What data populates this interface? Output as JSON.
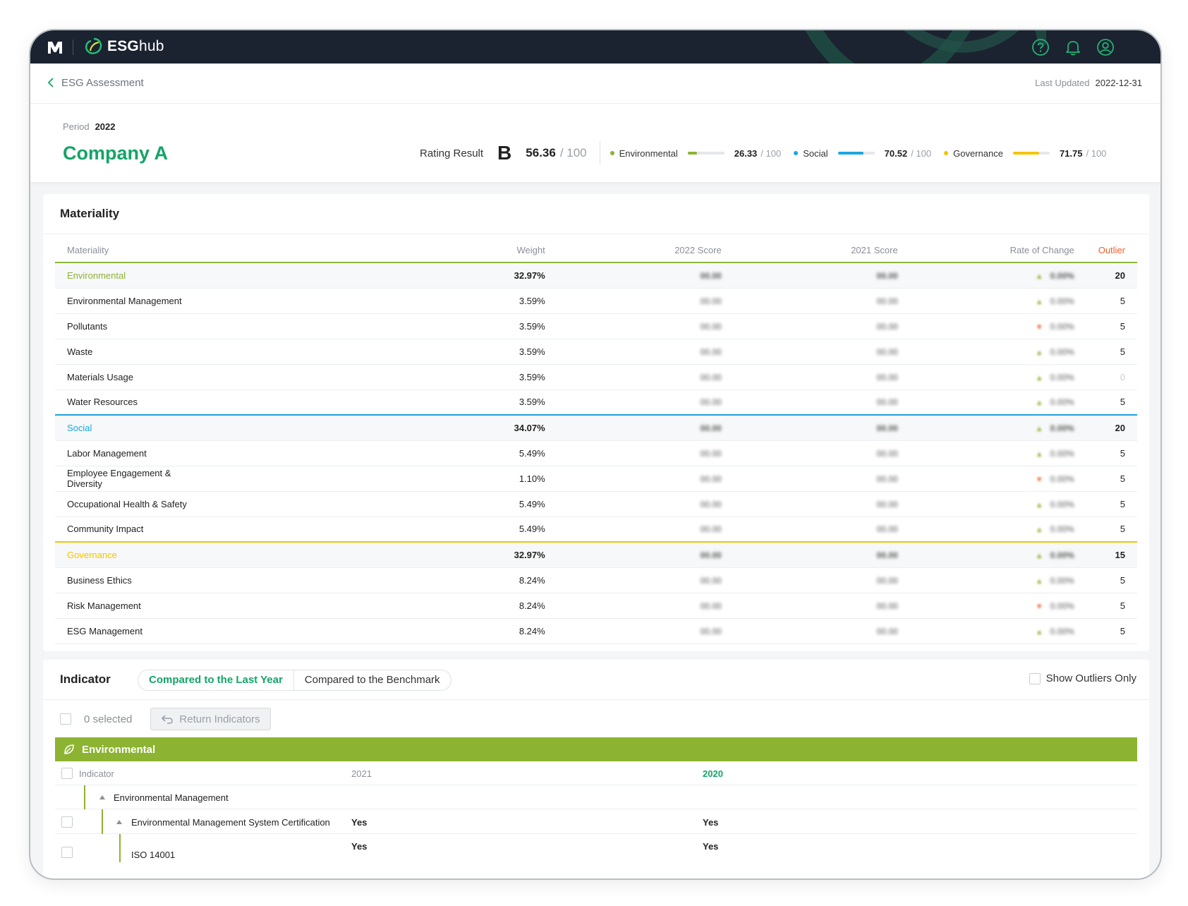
{
  "app": {
    "brand_bold": "ESG",
    "brand_light": "hub"
  },
  "header": {
    "back_label": "ESG Assessment",
    "last_updated_label": "Last Updated",
    "last_updated_value": "2022-12-31",
    "period_label": "Period",
    "period_value": "2022",
    "company": "Company A"
  },
  "rating": {
    "label": "Rating Result",
    "grade": "B",
    "score": "56.36",
    "out_of": "/ 100",
    "pillars": [
      {
        "name": "Environmental",
        "value": "26.33",
        "out_of": "/ 100",
        "fill": 0.2633,
        "color": "#8db332"
      },
      {
        "name": "Social",
        "value": "70.52",
        "out_of": "/ 100",
        "fill": 0.7052,
        "color": "#1aa7e0"
      },
      {
        "name": "Governance",
        "value": "71.75",
        "out_of": "/ 100",
        "fill": 0.7175,
        "color": "#f5c400"
      }
    ]
  },
  "materiality": {
    "title": "Materiality",
    "columns": [
      "Materiality",
      "Weight",
      "2022 Score",
      "2021 Score",
      "Rate of Change",
      "Outlier"
    ],
    "rows": [
      {
        "name": "Environmental",
        "weight": "32.97%",
        "s22": "00.00",
        "s21": "00.00",
        "rate": "0.00%",
        "dir": "up",
        "outlier": "20",
        "group": "env"
      },
      {
        "name": "Environmental Management",
        "weight": "3.59%",
        "s22": "00.00",
        "s21": "00.00",
        "rate": "0.00%",
        "dir": "up",
        "outlier": "5"
      },
      {
        "name": "Pollutants",
        "weight": "3.59%",
        "s22": "00.00",
        "s21": "00.00",
        "rate": "0.00%",
        "dir": "down",
        "outlier": "5"
      },
      {
        "name": "Waste",
        "weight": "3.59%",
        "s22": "00.00",
        "s21": "00.00",
        "rate": "0.00%",
        "dir": "up",
        "outlier": "5"
      },
      {
        "name": "Materials Usage",
        "weight": "3.59%",
        "s22": "00.00",
        "s21": "00.00",
        "rate": "0.00%",
        "dir": "up",
        "outlier": "0"
      },
      {
        "name": "Water Resources",
        "weight": "3.59%",
        "s22": "00.00",
        "s21": "00.00",
        "rate": "0.00%",
        "dir": "up",
        "outlier": "5"
      },
      {
        "name": "Social",
        "weight": "34.07%",
        "s22": "00.00",
        "s21": "00.00",
        "rate": "0.00%",
        "dir": "up",
        "outlier": "20",
        "group": "soc"
      },
      {
        "name": "Labor Management",
        "weight": "5.49%",
        "s22": "00.00",
        "s21": "00.00",
        "rate": "0.00%",
        "dir": "up",
        "outlier": "5"
      },
      {
        "name": "Employee Engagement & Diversity",
        "weight": "1.10%",
        "s22": "00.00",
        "s21": "00.00",
        "rate": "0.00%",
        "dir": "down",
        "outlier": "5"
      },
      {
        "name": "Occupational Health & Safety",
        "weight": "5.49%",
        "s22": "00.00",
        "s21": "00.00",
        "rate": "0.00%",
        "dir": "up",
        "outlier": "5"
      },
      {
        "name": "Community Impact",
        "weight": "5.49%",
        "s22": "00.00",
        "s21": "00.00",
        "rate": "0.00%",
        "dir": "up",
        "outlier": "5"
      },
      {
        "name": "Governance",
        "weight": "32.97%",
        "s22": "00.00",
        "s21": "00.00",
        "rate": "0.00%",
        "dir": "up",
        "outlier": "15",
        "group": "gov"
      },
      {
        "name": "Business Ethics",
        "weight": "8.24%",
        "s22": "00.00",
        "s21": "00.00",
        "rate": "0.00%",
        "dir": "up",
        "outlier": "5"
      },
      {
        "name": "Risk Management",
        "weight": "8.24%",
        "s22": "00.00",
        "s21": "00.00",
        "rate": "0.00%",
        "dir": "down",
        "outlier": "5"
      },
      {
        "name": "ESG Management",
        "weight": "8.24%",
        "s22": "00.00",
        "s21": "00.00",
        "rate": "0.00%",
        "dir": "up",
        "outlier": "5"
      }
    ],
    "group_colors": {
      "env": "#8db332",
      "soc": "#1aa7e0",
      "gov": "#f5c400"
    }
  },
  "indicator": {
    "title": "Indicator",
    "tabs": [
      "Compared to the Last Year",
      "Compared to the Benchmark"
    ],
    "show_outliers_label": "Show Outliers Only",
    "selected_label": "0 selected",
    "return_label": "Return Indicators",
    "section_label": "Environmental",
    "col_indicator": "Indicator",
    "col_2021": "2021",
    "col_2020": "2020",
    "group_row": "Environmental Management",
    "item_row": {
      "name": "Environmental Management System Certification",
      "v2021": "Yes",
      "v2020": "Yes"
    },
    "sub_row": {
      "name": "ISO 14001",
      "v2021": "Yes",
      "v2020": "Yes"
    }
  }
}
